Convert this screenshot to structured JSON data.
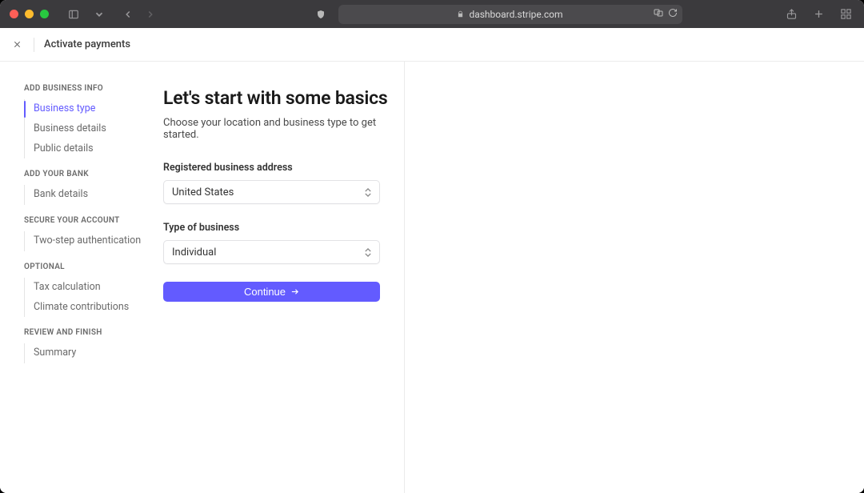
{
  "browser": {
    "url_display": "dashboard.stripe.com"
  },
  "header": {
    "title": "Activate payments"
  },
  "sidebar": {
    "sections": [
      {
        "title": "ADD BUSINESS INFO",
        "items": [
          {
            "label": "Business type",
            "active": true
          },
          {
            "label": "Business details",
            "active": false
          },
          {
            "label": "Public details",
            "active": false
          }
        ]
      },
      {
        "title": "ADD YOUR BANK",
        "items": [
          {
            "label": "Bank details",
            "active": false
          }
        ]
      },
      {
        "title": "SECURE YOUR ACCOUNT",
        "items": [
          {
            "label": "Two-step authentication",
            "active": false
          }
        ]
      },
      {
        "title": "OPTIONAL",
        "items": [
          {
            "label": "Tax calculation",
            "active": false
          },
          {
            "label": "Climate contributions",
            "active": false
          }
        ]
      },
      {
        "title": "REVIEW AND FINISH",
        "items": [
          {
            "label": "Summary",
            "active": false
          }
        ]
      }
    ]
  },
  "form": {
    "heading": "Let's start with some basics",
    "subheading": "Choose your location and business type to get started.",
    "fields": {
      "address": {
        "label": "Registered business address",
        "value": "United States"
      },
      "business_type": {
        "label": "Type of business",
        "value": "Individual"
      }
    },
    "continue_label": "Continue"
  },
  "colors": {
    "accent": "#635bff"
  }
}
